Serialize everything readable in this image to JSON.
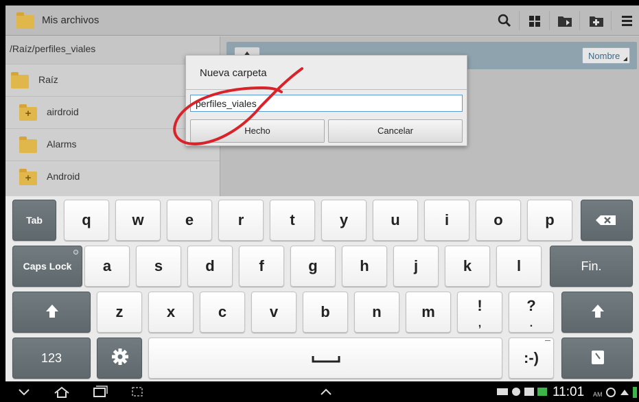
{
  "app": {
    "title": "Mis archivos",
    "path": "/Raíz/perfiles_viales",
    "sort_label": "Nombre",
    "tree": [
      {
        "label": "Raíz",
        "icon": "folder-icon"
      },
      {
        "label": "airdroid",
        "icon": "folder-add-icon"
      },
      {
        "label": "Alarms",
        "icon": "folder-icon"
      },
      {
        "label": "Android",
        "icon": "folder-add-icon"
      }
    ],
    "toolbar_icons": [
      "search-icon",
      "grid-view-icon",
      "folder-move-icon",
      "new-folder-icon",
      "menu-icon"
    ]
  },
  "dialog": {
    "title": "Nueva carpeta",
    "input_value": "perfiles_viales",
    "ok_label": "Hecho",
    "cancel_label": "Cancelar"
  },
  "keyboard": {
    "row1": {
      "tab": "Tab",
      "letters": [
        "q",
        "w",
        "e",
        "r",
        "t",
        "y",
        "u",
        "i",
        "o",
        "p"
      ],
      "backspace_icon": "backspace-icon"
    },
    "row2": {
      "caps": "Caps Lock",
      "letters": [
        "a",
        "s",
        "d",
        "f",
        "g",
        "h",
        "j",
        "k",
        "l"
      ],
      "enter": "Fin."
    },
    "row3": {
      "letters": [
        "z",
        "x",
        "c",
        "v",
        "b",
        "n",
        "m"
      ],
      "punct1": [
        "!",
        ","
      ],
      "punct2": [
        "?",
        "."
      ],
      "shift_icon": "shift-icon"
    },
    "row4": {
      "num": "123",
      "settings_icon": "gear-icon",
      "smiley": ":-)",
      "clipboard_icon": "clipboard-icon"
    }
  },
  "statusbar": {
    "time": "11:01",
    "ampm": "AM"
  },
  "colors": {
    "annotation": "#d9232a",
    "dark_key": "#687276",
    "folder": "#e0b74b"
  }
}
